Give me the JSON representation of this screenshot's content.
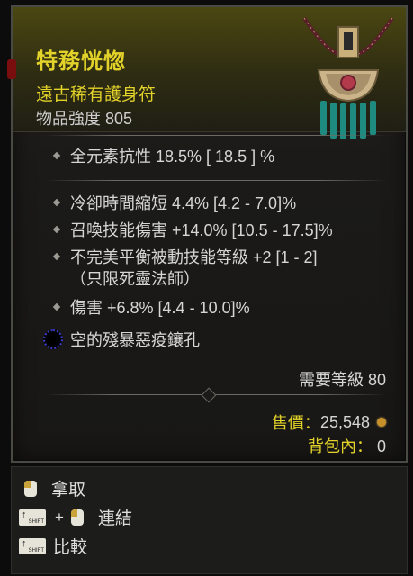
{
  "item": {
    "name": "特務恍惚",
    "type": "遠古稀有護身符",
    "power": "物品強度 805",
    "rarity_color": "#e2d22a"
  },
  "affixes": {
    "implicit": "全元素抗性 18.5%  [ 18.5 ] %",
    "cooldown": "冷卻時間縮短 4.4% [4.2 - 7.0]%",
    "summon_damage": "召喚技能傷害 +14.0% [10.5 - 17.5]%",
    "passive_line1": "不完美平衡被動技能等級 +2 [1 - 2]",
    "passive_line2": "（只限死靈法師）",
    "damage": "傷害 +6.8% [4.4 - 10.0]%",
    "socket": "空的殘暴惡疫鑲孔"
  },
  "requirements": {
    "level": "需要等級 80"
  },
  "sell": {
    "price_label": "售價：",
    "price_value": "25,548",
    "stash_label": "背包內：",
    "stash_value": "0"
  },
  "actions": {
    "pickup": "拿取",
    "link": "連結",
    "compare": "比較",
    "plus": "+",
    "shift_key": "SHIFT"
  },
  "icons": {
    "bullet": "diamond-bullet-icon",
    "socket": "empty-socket-icon",
    "gold": "gold-coin-icon",
    "mouse": "left-mouse-icon",
    "shift": "shift-key-icon"
  }
}
